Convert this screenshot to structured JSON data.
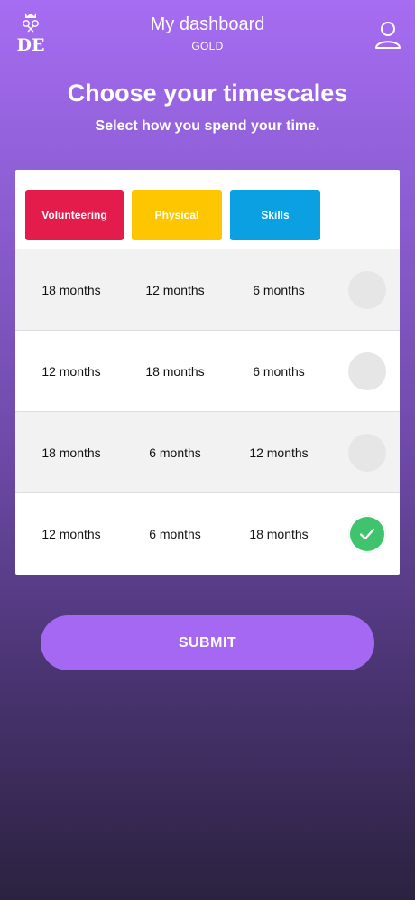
{
  "header": {
    "title": "My dashboard",
    "level": "GOLD",
    "logo_text": "DE",
    "profile_icon": "user-icon"
  },
  "intro": {
    "title": "Choose your timescales",
    "subtitle": "Select how you spend your time."
  },
  "legend": {
    "volunteering": "Volunteering",
    "physical": "Physical",
    "skills": "Skills"
  },
  "colors": {
    "volunteering": "#e31c4c",
    "physical": "#fec600",
    "skills": "#0aa0e2",
    "selected": "#3fc46d",
    "submit": "#a568f2"
  },
  "options": [
    {
      "volunteering": "18 months",
      "physical": "12 months",
      "skills": "6 months",
      "selected": false
    },
    {
      "volunteering": "12 months",
      "physical": "18 months",
      "skills": "6 months",
      "selected": false
    },
    {
      "volunteering": "18 months",
      "physical": "6 months",
      "skills": "12 months",
      "selected": false
    },
    {
      "volunteering": "12 months",
      "physical": "6 months",
      "skills": "18 months",
      "selected": true
    }
  ],
  "actions": {
    "submit_label": "SUBMIT"
  }
}
